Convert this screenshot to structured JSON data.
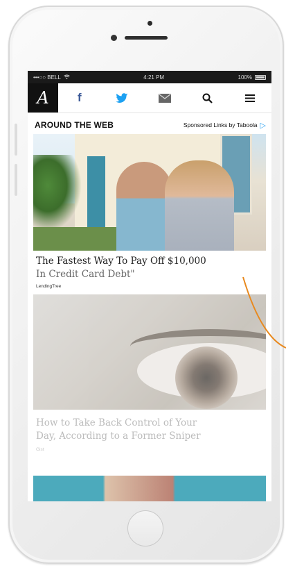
{
  "status_bar": {
    "carrier": "•••○○ BELL",
    "time": "4:21 PM",
    "battery": "100%"
  },
  "nav": {
    "logo_letter": "A",
    "icons": [
      "facebook-icon",
      "twitter-icon",
      "mail-icon",
      "search-icon",
      "menu-icon"
    ]
  },
  "section": {
    "title": "AROUND THE WEB",
    "sponsored": "Sponsored Links by Taboola"
  },
  "articles": [
    {
      "headline_line1": "The Fastest Way To Pay Off $10,000",
      "headline_line2": "In Credit Card Debt\"",
      "source": "LendingTree"
    },
    {
      "headline_line1": "How to Take Back Control of Your",
      "headline_line2": "Day, According to a Former Sniper",
      "source": "Gist"
    }
  ],
  "colors": {
    "accent_arrow": "#e8891e",
    "facebook": "#3b5998",
    "twitter": "#1da1f2",
    "taboola": "#2ea3f2"
  }
}
